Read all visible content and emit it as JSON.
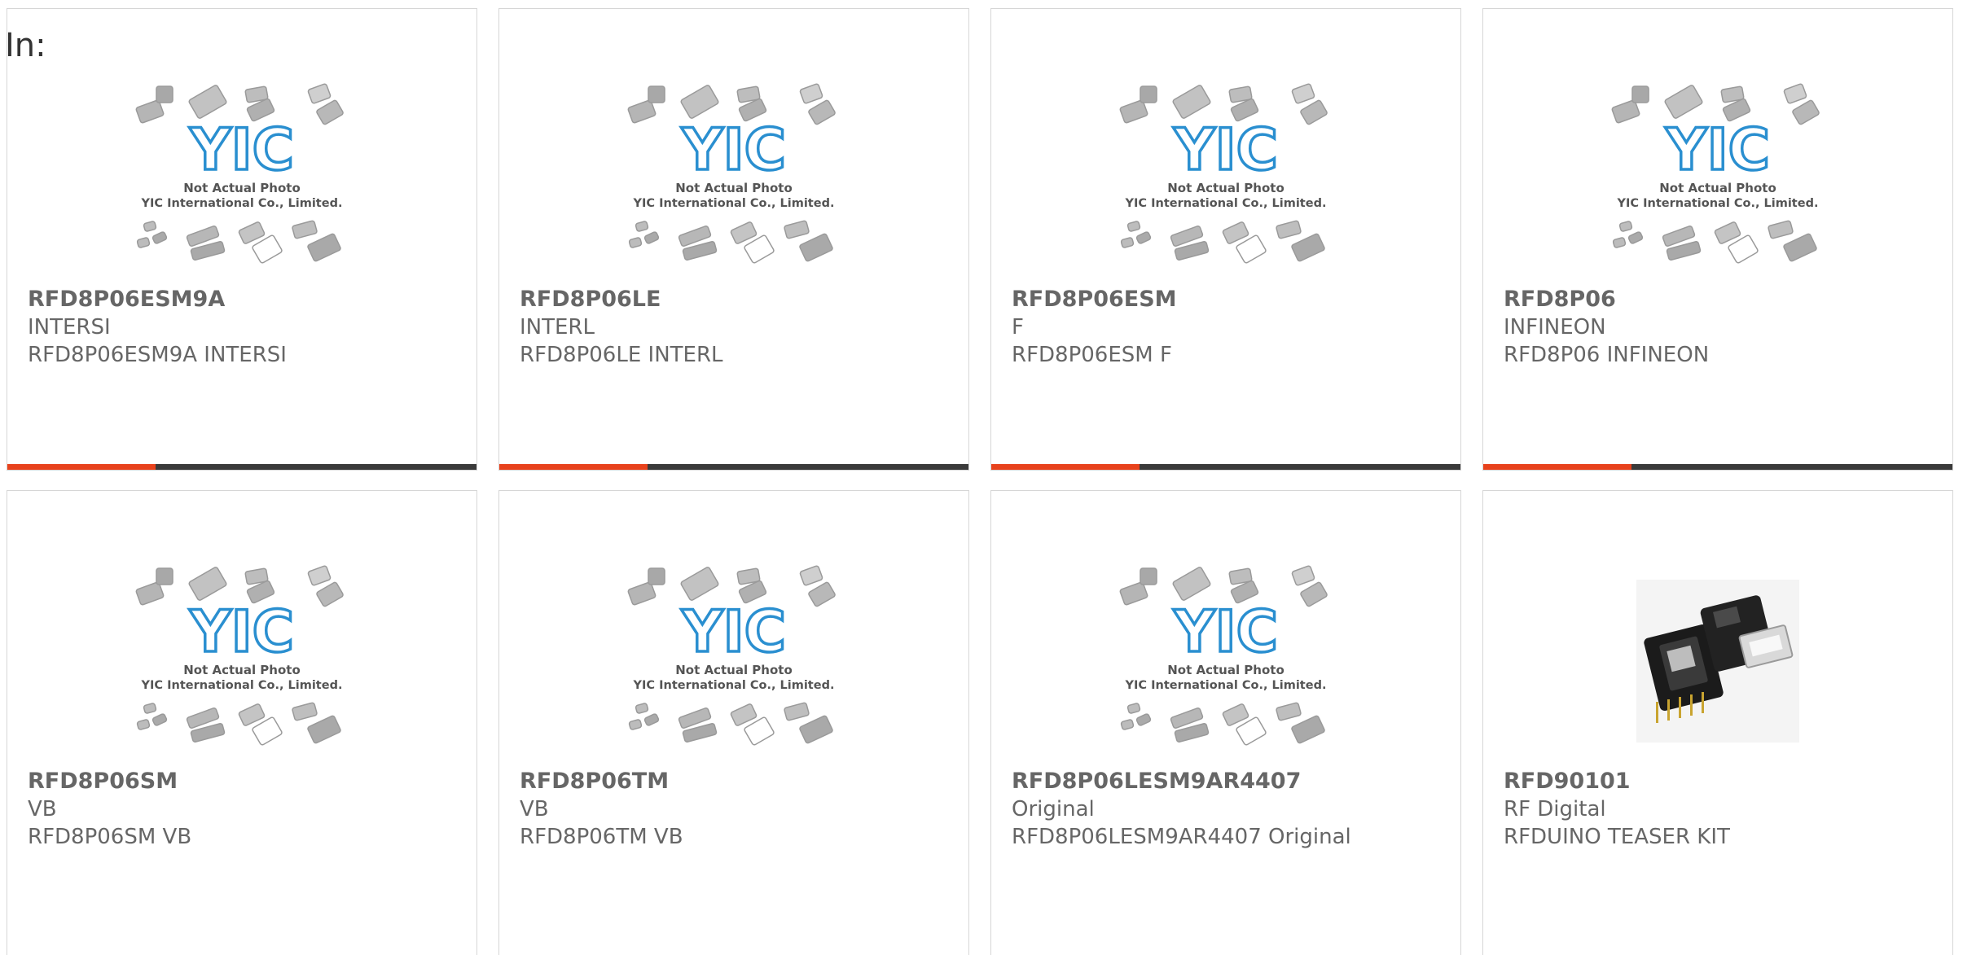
{
  "page": {
    "in_label": "In:"
  },
  "placeholder": {
    "line1": "Not Actual Photo",
    "line2": "YIC International Co., Limited.",
    "logo": "YIC"
  },
  "colors": {
    "accent": "#e8421c",
    "bar": "#3a3a3a",
    "logo": "#2a8fd0",
    "text": "#666666"
  },
  "products": [
    {
      "part": "RFD8P06ESM9A",
      "brand": "INTERSI",
      "desc": "RFD8P06ESM9A INTERSI",
      "image": "placeholder"
    },
    {
      "part": "RFD8P06LE",
      "brand": "INTERL",
      "desc": "RFD8P06LE INTERL",
      "image": "placeholder"
    },
    {
      "part": "RFD8P06ESM",
      "brand": "F",
      "desc": "RFD8P06ESM F",
      "image": "placeholder"
    },
    {
      "part": "RFD8P06",
      "brand": "INFINEON",
      "desc": "RFD8P06 INFINEON",
      "image": "placeholder"
    },
    {
      "part": "RFD8P06SM",
      "brand": "VB",
      "desc": "RFD8P06SM VB",
      "image": "placeholder"
    },
    {
      "part": "RFD8P06TM",
      "brand": "VB",
      "desc": "RFD8P06TM VB",
      "image": "placeholder"
    },
    {
      "part": "RFD8P06LESM9AR4407",
      "brand": "Original",
      "desc": "RFD8P06LESM9AR4407 Original",
      "image": "placeholder"
    },
    {
      "part": "RFD90101",
      "brand": "RF Digital",
      "desc": "RFDUINO TEASER KIT",
      "image": "rfduino-kit-photo"
    }
  ]
}
